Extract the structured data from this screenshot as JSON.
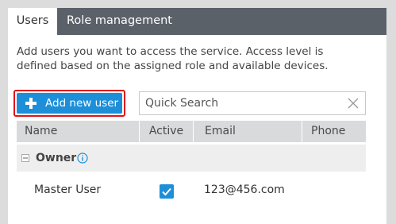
{
  "tabs": [
    {
      "label": "Users",
      "active": true
    },
    {
      "label": "Role management",
      "active": false
    }
  ],
  "description": "Add users you want to access the service. Access level is defined based on the assigned role and available devices.",
  "toolbar": {
    "add_label": "Add new user",
    "search_placeholder": "Quick Search"
  },
  "table": {
    "columns": [
      "Name",
      "Active",
      "Email",
      "Phone"
    ],
    "groups": [
      {
        "name": "Owner",
        "expanded": true,
        "rows": [
          {
            "name": "Master User",
            "active": true,
            "email": "123@456.com",
            "phone": ""
          }
        ]
      }
    ]
  },
  "colors": {
    "accent": "#1d8fd8",
    "highlight_border": "#e0121a",
    "tabbar": "#5b6169"
  }
}
